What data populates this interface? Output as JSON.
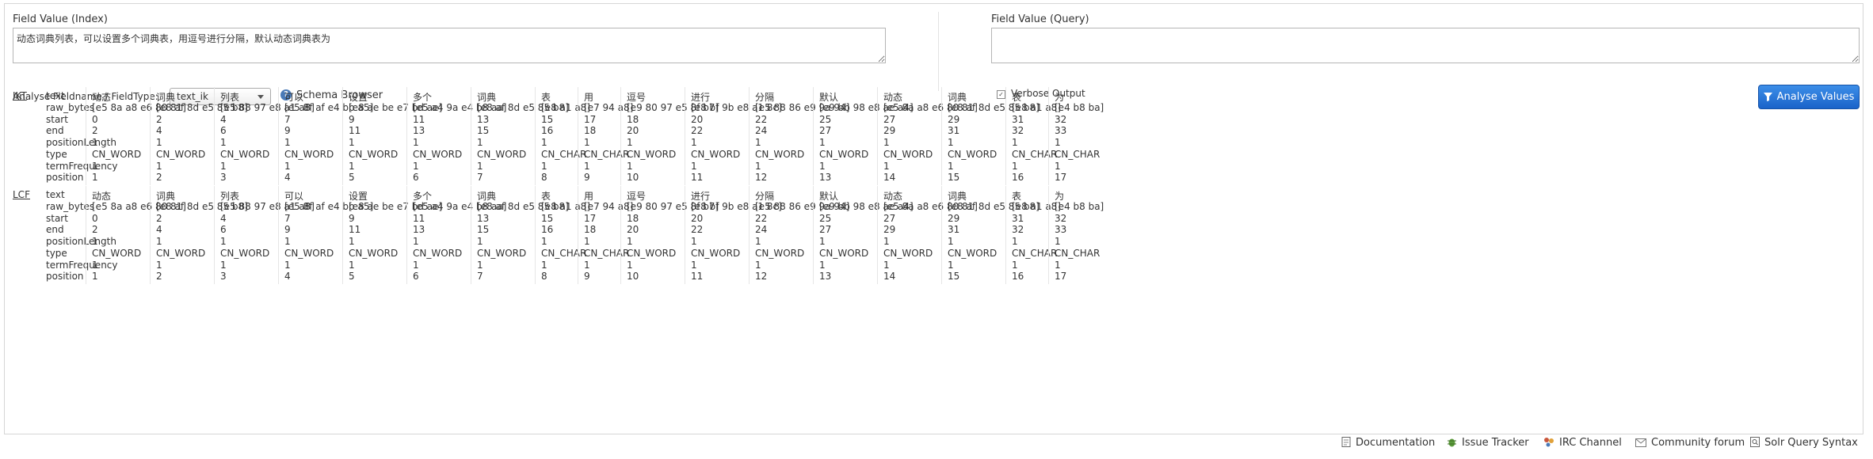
{
  "index_field": {
    "label": "Field Value (Index)",
    "value": "动态词典列表，可以设置多个词典表，用逗号进行分隔，默认动态词典表为"
  },
  "query_field": {
    "label": "Field Value (Query)",
    "value": ""
  },
  "fieldtype": {
    "label": "Analyse Fieldname / FieldType:",
    "selected": "text_ik"
  },
  "schema_browser": {
    "label": "Schema Browser",
    "icon": "help-icon"
  },
  "verbose": {
    "label": "Verbose Output",
    "checked": true
  },
  "analyse_button": {
    "label": "Analyse Values",
    "icon": "filter-icon"
  },
  "attributes": [
    "text",
    "raw_bytes",
    "start",
    "end",
    "positionLength",
    "type",
    "termFrequency",
    "position"
  ],
  "groups": [
    {
      "name": "IKT",
      "tokens": [
        {
          "text": "动态",
          "raw_bytes": "[e5 8a a8 e6 80 81]",
          "start": "0",
          "end": "2",
          "positionLength": "1",
          "type": "CN_WORD",
          "termFrequency": "1",
          "position": "1"
        },
        {
          "text": "词典",
          "raw_bytes": "[e8 af 8d e5 85 b8]",
          "start": "2",
          "end": "4",
          "positionLength": "1",
          "type": "CN_WORD",
          "termFrequency": "1",
          "position": "2"
        },
        {
          "text": "列表",
          "raw_bytes": "[e5 88 97 e8 a1 a8]",
          "start": "4",
          "end": "6",
          "positionLength": "1",
          "type": "CN_WORD",
          "termFrequency": "1",
          "position": "3"
        },
        {
          "text": "可以",
          "raw_bytes": "[e5 8f af e4 bb a5]",
          "start": "7",
          "end": "9",
          "positionLength": "1",
          "type": "CN_WORD",
          "termFrequency": "1",
          "position": "4"
        },
        {
          "text": "设置",
          "raw_bytes": "[e8 ae be e7 bd ae]",
          "start": "9",
          "end": "11",
          "positionLength": "1",
          "type": "CN_WORD",
          "termFrequency": "1",
          "position": "5"
        },
        {
          "text": "多个",
          "raw_bytes": "[e5 a4 9a e4 b8 aa]",
          "start": "11",
          "end": "13",
          "positionLength": "1",
          "type": "CN_WORD",
          "termFrequency": "1",
          "position": "6"
        },
        {
          "text": "词典",
          "raw_bytes": "[e8 af 8d e5 85 b8]",
          "start": "13",
          "end": "15",
          "positionLength": "1",
          "type": "CN_WORD",
          "termFrequency": "1",
          "position": "7"
        },
        {
          "text": "表",
          "raw_bytes": "[e8 a1 a8]",
          "start": "15",
          "end": "16",
          "positionLength": "1",
          "type": "CN_CHAR",
          "termFrequency": "1",
          "position": "8"
        },
        {
          "text": "用",
          "raw_bytes": "[e7 94 a8]",
          "start": "17",
          "end": "18",
          "positionLength": "1",
          "type": "CN_CHAR",
          "termFrequency": "1",
          "position": "9"
        },
        {
          "text": "逗号",
          "raw_bytes": "[e9 80 97 e5 8f b7]",
          "start": "18",
          "end": "20",
          "positionLength": "1",
          "type": "CN_WORD",
          "termFrequency": "1",
          "position": "10"
        },
        {
          "text": "进行",
          "raw_bytes": "[e8 bf 9b e8 a1 8c]",
          "start": "20",
          "end": "22",
          "positionLength": "1",
          "type": "CN_WORD",
          "termFrequency": "1",
          "position": "11"
        },
        {
          "text": "分隔",
          "raw_bytes": "[e5 88 86 e9 9a 94]",
          "start": "22",
          "end": "24",
          "positionLength": "1",
          "type": "CN_WORD",
          "termFrequency": "1",
          "position": "12"
        },
        {
          "text": "默认",
          "raw_bytes": "[e9 bb 98 e8 ae a4]",
          "start": "25",
          "end": "27",
          "positionLength": "1",
          "type": "CN_WORD",
          "termFrequency": "1",
          "position": "13"
        },
        {
          "text": "动态",
          "raw_bytes": "[e5 8a a8 e6 80 81]",
          "start": "27",
          "end": "29",
          "positionLength": "1",
          "type": "CN_WORD",
          "termFrequency": "1",
          "position": "14"
        },
        {
          "text": "词典",
          "raw_bytes": "[e8 af 8d e5 85 b8]",
          "start": "29",
          "end": "31",
          "positionLength": "1",
          "type": "CN_WORD",
          "termFrequency": "1",
          "position": "15"
        },
        {
          "text": "表",
          "raw_bytes": "[e8 a1 a8]",
          "start": "31",
          "end": "32",
          "positionLength": "1",
          "type": "CN_CHAR",
          "termFrequency": "1",
          "position": "16"
        },
        {
          "text": "为",
          "raw_bytes": "[e4 b8 ba]",
          "start": "32",
          "end": "33",
          "positionLength": "1",
          "type": "CN_CHAR",
          "termFrequency": "1",
          "position": "17"
        }
      ]
    },
    {
      "name": "LCF",
      "tokens": [
        {
          "text": "动态",
          "raw_bytes": "[e5 8a a8 e6 80 81]",
          "start": "0",
          "end": "2",
          "positionLength": "1",
          "type": "CN_WORD",
          "termFrequency": "1",
          "position": "1"
        },
        {
          "text": "词典",
          "raw_bytes": "[e8 af 8d e5 85 b8]",
          "start": "2",
          "end": "4",
          "positionLength": "1",
          "type": "CN_WORD",
          "termFrequency": "1",
          "position": "2"
        },
        {
          "text": "列表",
          "raw_bytes": "[e5 88 97 e8 a1 a8]",
          "start": "4",
          "end": "6",
          "positionLength": "1",
          "type": "CN_WORD",
          "termFrequency": "1",
          "position": "3"
        },
        {
          "text": "可以",
          "raw_bytes": "[e5 8f af e4 bb a5]",
          "start": "7",
          "end": "9",
          "positionLength": "1",
          "type": "CN_WORD",
          "termFrequency": "1",
          "position": "4"
        },
        {
          "text": "设置",
          "raw_bytes": "[e8 ae be e7 bd ae]",
          "start": "9",
          "end": "11",
          "positionLength": "1",
          "type": "CN_WORD",
          "termFrequency": "1",
          "position": "5"
        },
        {
          "text": "多个",
          "raw_bytes": "[e5 a4 9a e4 b8 aa]",
          "start": "11",
          "end": "13",
          "positionLength": "1",
          "type": "CN_WORD",
          "termFrequency": "1",
          "position": "6"
        },
        {
          "text": "词典",
          "raw_bytes": "[e8 af 8d e5 85 b8]",
          "start": "13",
          "end": "15",
          "positionLength": "1",
          "type": "CN_WORD",
          "termFrequency": "1",
          "position": "7"
        },
        {
          "text": "表",
          "raw_bytes": "[e8 a1 a8]",
          "start": "15",
          "end": "16",
          "positionLength": "1",
          "type": "CN_CHAR",
          "termFrequency": "1",
          "position": "8"
        },
        {
          "text": "用",
          "raw_bytes": "[e7 94 a8]",
          "start": "17",
          "end": "18",
          "positionLength": "1",
          "type": "CN_CHAR",
          "termFrequency": "1",
          "position": "9"
        },
        {
          "text": "逗号",
          "raw_bytes": "[e9 80 97 e5 8f b7]",
          "start": "18",
          "end": "20",
          "positionLength": "1",
          "type": "CN_WORD",
          "termFrequency": "1",
          "position": "10"
        },
        {
          "text": "进行",
          "raw_bytes": "[e8 bf 9b e8 a1 8c]",
          "start": "20",
          "end": "22",
          "positionLength": "1",
          "type": "CN_WORD",
          "termFrequency": "1",
          "position": "11"
        },
        {
          "text": "分隔",
          "raw_bytes": "[e5 88 86 e9 9a 94]",
          "start": "22",
          "end": "24",
          "positionLength": "1",
          "type": "CN_WORD",
          "termFrequency": "1",
          "position": "12"
        },
        {
          "text": "默认",
          "raw_bytes": "[e9 bb 98 e8 ae a4]",
          "start": "25",
          "end": "27",
          "positionLength": "1",
          "type": "CN_WORD",
          "termFrequency": "1",
          "position": "13"
        },
        {
          "text": "动态",
          "raw_bytes": "[e5 8a a8 e6 80 81]",
          "start": "27",
          "end": "29",
          "positionLength": "1",
          "type": "CN_WORD",
          "termFrequency": "1",
          "position": "14"
        },
        {
          "text": "词典",
          "raw_bytes": "[e8 af 8d e5 85 b8]",
          "start": "29",
          "end": "31",
          "positionLength": "1",
          "type": "CN_WORD",
          "termFrequency": "1",
          "position": "15"
        },
        {
          "text": "表",
          "raw_bytes": "[e8 a1 a8]",
          "start": "31",
          "end": "32",
          "positionLength": "1",
          "type": "CN_CHAR",
          "termFrequency": "1",
          "position": "16"
        },
        {
          "text": "为",
          "raw_bytes": "[e4 b8 ba]",
          "start": "32",
          "end": "33",
          "positionLength": "1",
          "type": "CN_CHAR",
          "termFrequency": "1",
          "position": "17"
        }
      ]
    }
  ],
  "footer": [
    {
      "label": "Documentation",
      "icon": "document-icon"
    },
    {
      "label": "Issue Tracker",
      "icon": "bug-icon"
    },
    {
      "label": "IRC Channel",
      "icon": "chat-icon"
    },
    {
      "label": "Community forum",
      "icon": "mail-icon"
    },
    {
      "label": "Solr Query Syntax",
      "icon": "query-icon"
    }
  ],
  "colors": {
    "accent": "#1a63c9",
    "border": "#d6d6d6",
    "text": "#333333"
  }
}
